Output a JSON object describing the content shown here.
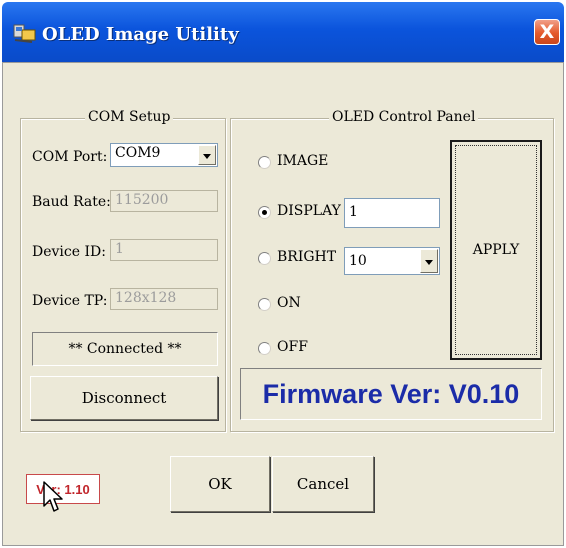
{
  "window": {
    "title": "OLED Image Utility",
    "close_glyph": "X",
    "icon": "app-icon"
  },
  "com_setup": {
    "title": "COM Setup",
    "com_port_label": "COM Port:",
    "com_port_value": "COM9",
    "baud_rate_label": "Baud Rate:",
    "baud_rate_value": "115200",
    "device_id_label": "Device ID:",
    "device_id_value": "1",
    "device_tp_label": "Device TP:",
    "device_tp_value": "128x128",
    "status": "** Connected **",
    "disconnect_label": "Disconnect"
  },
  "oled_panel": {
    "title": "OLED Control Panel",
    "options": [
      {
        "label": "IMAGE",
        "checked": false
      },
      {
        "label": "DISPLAY",
        "checked": true
      },
      {
        "label": "BRIGHT",
        "checked": false
      },
      {
        "label": "ON",
        "checked": false
      },
      {
        "label": "OFF",
        "checked": false
      }
    ],
    "display_value": "1",
    "bright_value": "10",
    "apply_label": "APPLY",
    "firmware": "Firmware Ver: V0.10"
  },
  "footer": {
    "version": "Ver: 1.10",
    "ok_label": "OK",
    "cancel_label": "Cancel"
  },
  "colors": {
    "titlebar": "#0b54dc",
    "dialog_bg": "#ece9d8",
    "firmware_text": "#1b2ca8",
    "version_text": "#c1262c",
    "close_button": "#e55a2c"
  }
}
